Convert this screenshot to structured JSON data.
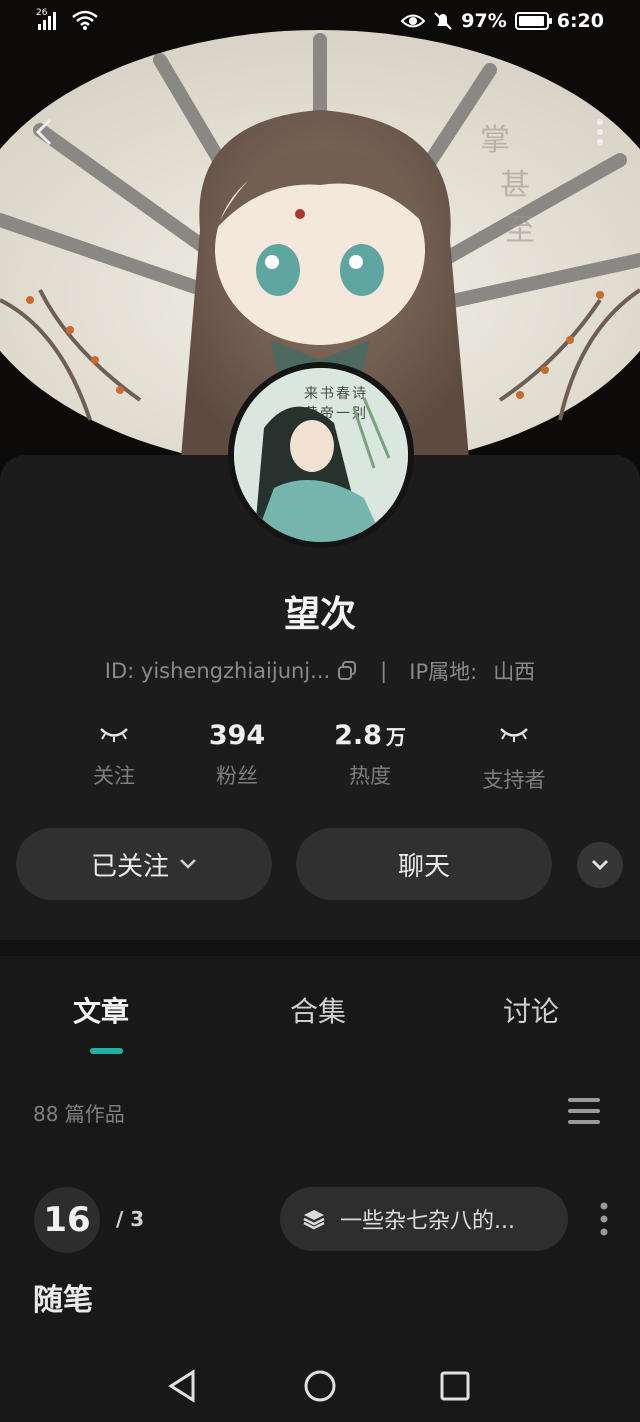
{
  "status_bar": {
    "network": "26",
    "battery": "97%",
    "battery_level": 0.97,
    "time": "6:20"
  },
  "profile": {
    "name": "望次",
    "id_text": "ID: yishengzhiaijunj...",
    "ip_label": "IP属地:",
    "ip_location": "山西",
    "separator": "|"
  },
  "stats": [
    {
      "value": "",
      "unit": "",
      "label": "关注",
      "icon": "eye-closed-icon"
    },
    {
      "value": "394",
      "unit": "",
      "label": "粉丝"
    },
    {
      "value": "2.8",
      "unit": "万",
      "label": "热度"
    },
    {
      "value": "",
      "unit": "",
      "label": "支持者",
      "icon": "eye-closed-icon"
    }
  ],
  "actions": {
    "follow_label": "已关注",
    "chat_label": "聊天"
  },
  "tabs": [
    {
      "label": "文章",
      "active": true
    },
    {
      "label": "合集",
      "active": false
    },
    {
      "label": "讨论",
      "active": false
    }
  ],
  "works_count": "88 篇作品",
  "collection": {
    "current": "16",
    "total": "/ 3",
    "name": "一些杂七杂八的...",
    "section_title": "随笔"
  },
  "colors": {
    "accent": "#22b2a5",
    "background": "#181818",
    "card": "#1c1c1c"
  }
}
